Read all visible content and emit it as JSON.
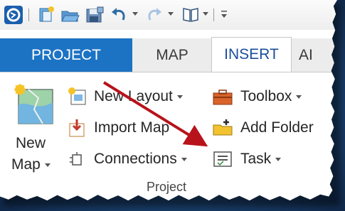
{
  "tabs": {
    "project": "PROJECT",
    "map": "MAP",
    "insert": "INSERT",
    "analysis": "AI"
  },
  "ribbon": {
    "new_map": {
      "line1": "New",
      "line2": "Map"
    },
    "new_layout": "New Layout",
    "import_map": "Import Map",
    "connections": "Connections",
    "toolbox": "Toolbox",
    "add_folder": "Add Folder",
    "task": "Task",
    "group_label": "Project"
  },
  "colors": {
    "project_tab": "#1c73c4",
    "insert_tab_text": "#1a4d9a",
    "arrow": "#b8131b"
  },
  "icons": {
    "app": "arcgis-pro-logo-icon",
    "qat": [
      "new-project-icon",
      "open-project-icon",
      "save-project-icon",
      "undo-icon",
      "redo-icon",
      "view-icon",
      "customize-icon"
    ]
  }
}
